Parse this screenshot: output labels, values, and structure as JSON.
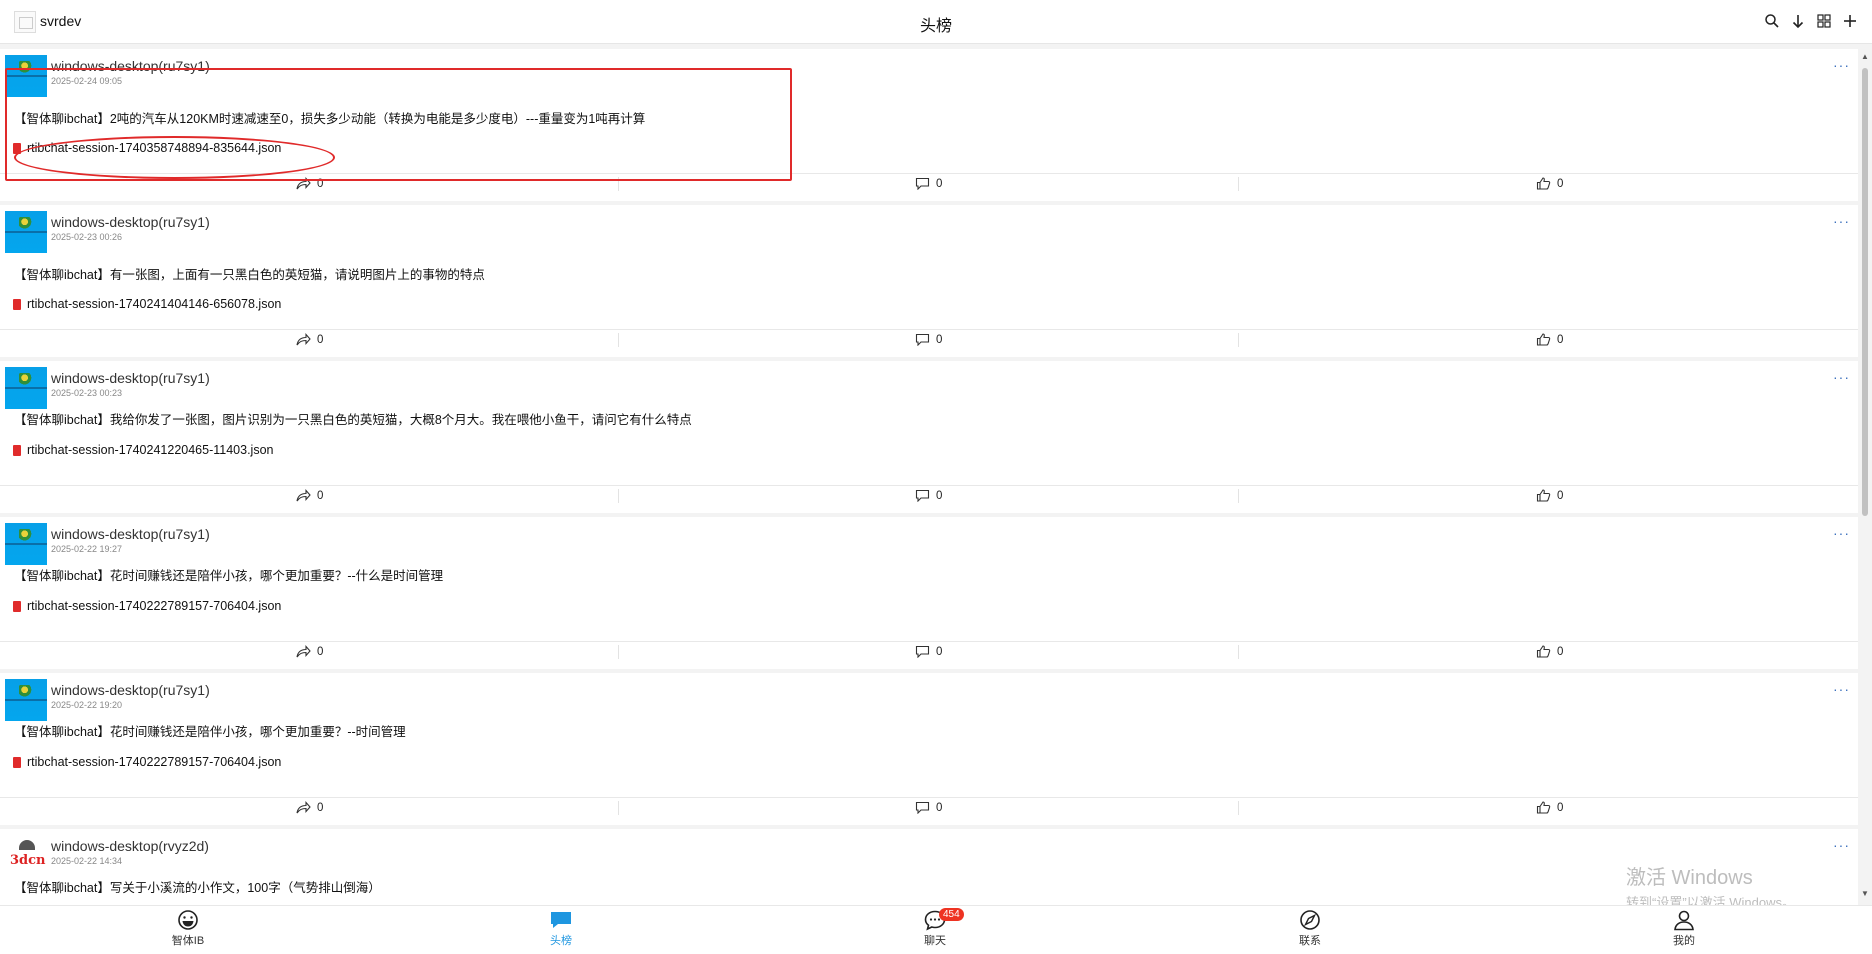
{
  "app": {
    "name": "svrdev"
  },
  "header": {
    "title": "头榜"
  },
  "header_icons": [
    "search-icon",
    "download-icon",
    "grid-icon",
    "add-icon"
  ],
  "posts": [
    {
      "user": "windows-desktop(ru7sy1)",
      "time": "2025-02-24 09:05",
      "text": "【智体聊ibchat】2吨的汽车从120KM时速减速至0，损失多少动能（转换为电能是多少度电）---重量变为1吨再计算",
      "attachment": "rtibchat-session-1740358748894-835644.json",
      "shares": "0",
      "comments": "0",
      "likes": "0"
    },
    {
      "user": "windows-desktop(ru7sy1)",
      "time": "2025-02-23 00:26",
      "text": "【智体聊ibchat】有一张图，上面有一只黑白色的英短猫，请说明图片上的事物的特点",
      "attachment": "rtibchat-session-1740241404146-656078.json",
      "shares": "0",
      "comments": "0",
      "likes": "0"
    },
    {
      "user": "windows-desktop(ru7sy1)",
      "time": "2025-02-23 00:23",
      "text": "【智体聊ibchat】我给你发了一张图，图片识别为一只黑白色的英短猫，大概8个月大。我在喂他小鱼干，请问它有什么特点",
      "attachment": "rtibchat-session-1740241220465-11403.json",
      "shares": "0",
      "comments": "0",
      "likes": "0"
    },
    {
      "user": "windows-desktop(ru7sy1)",
      "time": "2025-02-22 19:27",
      "text": "【智体聊ibchat】花时间赚钱还是陪伴小孩，哪个更加重要？--什么是时间管理",
      "attachment": "rtibchat-session-1740222789157-706404.json",
      "shares": "0",
      "comments": "0",
      "likes": "0"
    },
    {
      "user": "windows-desktop(ru7sy1)",
      "time": "2025-02-22 19:20",
      "text": "【智体聊ibchat】花时间赚钱还是陪伴小孩，哪个更加重要？--时间管理",
      "attachment": "rtibchat-session-1740222789157-706404.json",
      "shares": "0",
      "comments": "0",
      "likes": "0"
    },
    {
      "user": "windows-desktop(rvyz2d)",
      "time": "2025-02-22 14:34",
      "text": "【智体聊ibchat】写关于小溪流的小作文，100字（气势排山倒海）",
      "avatar_text": "3dcn"
    }
  ],
  "watermark": {
    "title": "激活 Windows",
    "subtitle": "转到“设置”以激活 Windows。"
  },
  "nav": {
    "items": [
      {
        "label": "智体IB",
        "icon": "smiley-icon"
      },
      {
        "label": "头榜",
        "icon": "chat-bubble-icon",
        "active": true
      },
      {
        "label": "聊天",
        "icon": "message-icon",
        "badge": "454"
      },
      {
        "label": "联系",
        "icon": "compass-icon"
      },
      {
        "label": "我的",
        "icon": "user-icon"
      }
    ]
  },
  "colors": {
    "accent": "#1e96e0",
    "highlight": "#e02a2a",
    "file_icon": "#e02b2b",
    "badge": "#e33322"
  }
}
